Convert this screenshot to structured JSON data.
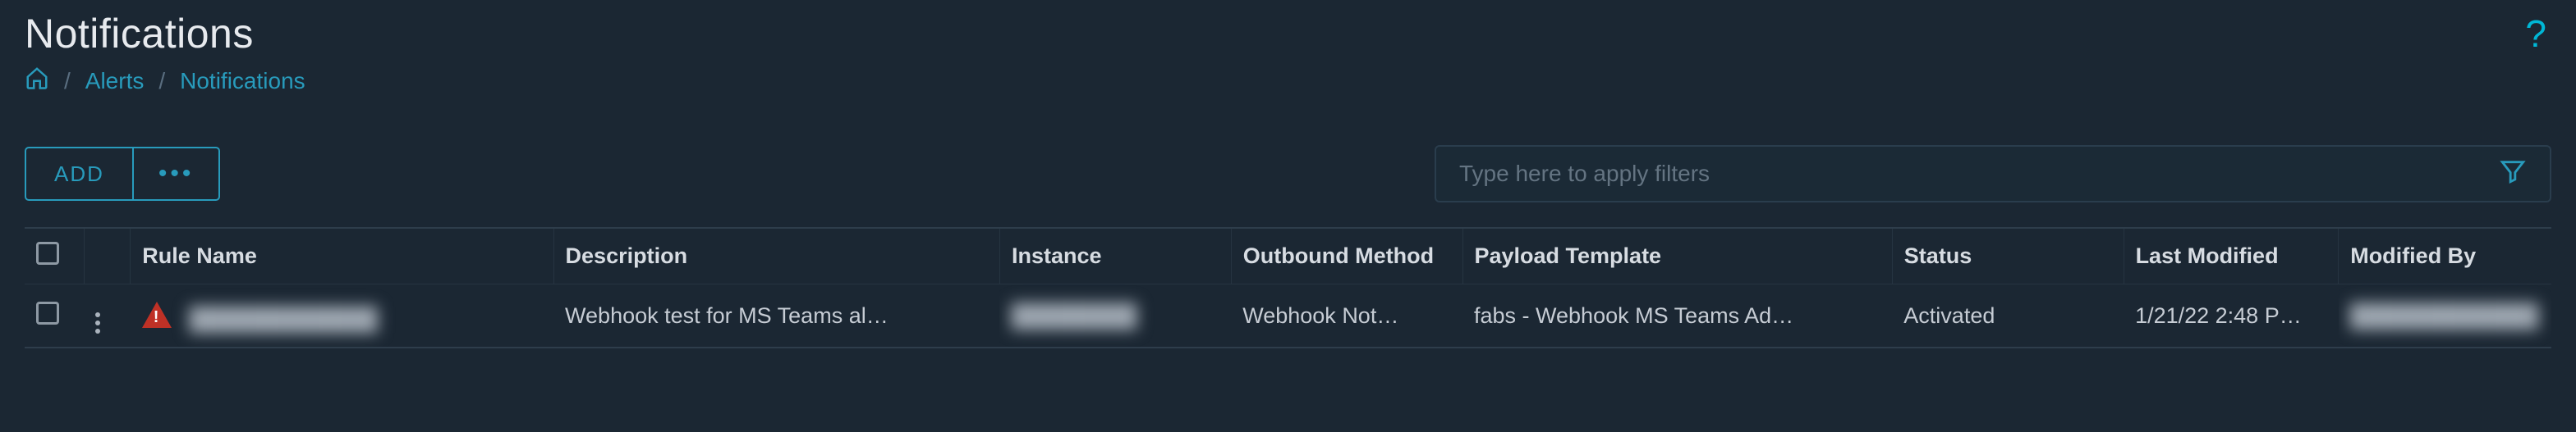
{
  "page": {
    "title": "Notifications",
    "helpGlyph": "?"
  },
  "breadcrumb": {
    "homeName": "home",
    "items": [
      "Alerts",
      "Notifications"
    ]
  },
  "toolbar": {
    "addLabel": "ADD",
    "moreDots": "•••"
  },
  "filter": {
    "placeholder": "Type here to apply filters"
  },
  "columns": {
    "ruleName": "Rule Name",
    "description": "Description",
    "instance": "Instance",
    "outbound": "Outbound Method",
    "payload": "Payload Template",
    "status": "Status",
    "lastModified": "Last Modified",
    "modifiedBy": "Modified By"
  },
  "rows": [
    {
      "hasAlert": true,
      "ruleNameBlurred": "████████████",
      "description": "Webhook test for MS Teams al…",
      "instanceBlurred": "████████",
      "outbound": "Webhook Not…",
      "payload": "fabs - Webhook MS Teams Ad…",
      "status": "Activated",
      "lastModified": "1/21/22 2:48 P…",
      "modifiedByBlurred": "████████████"
    }
  ]
}
